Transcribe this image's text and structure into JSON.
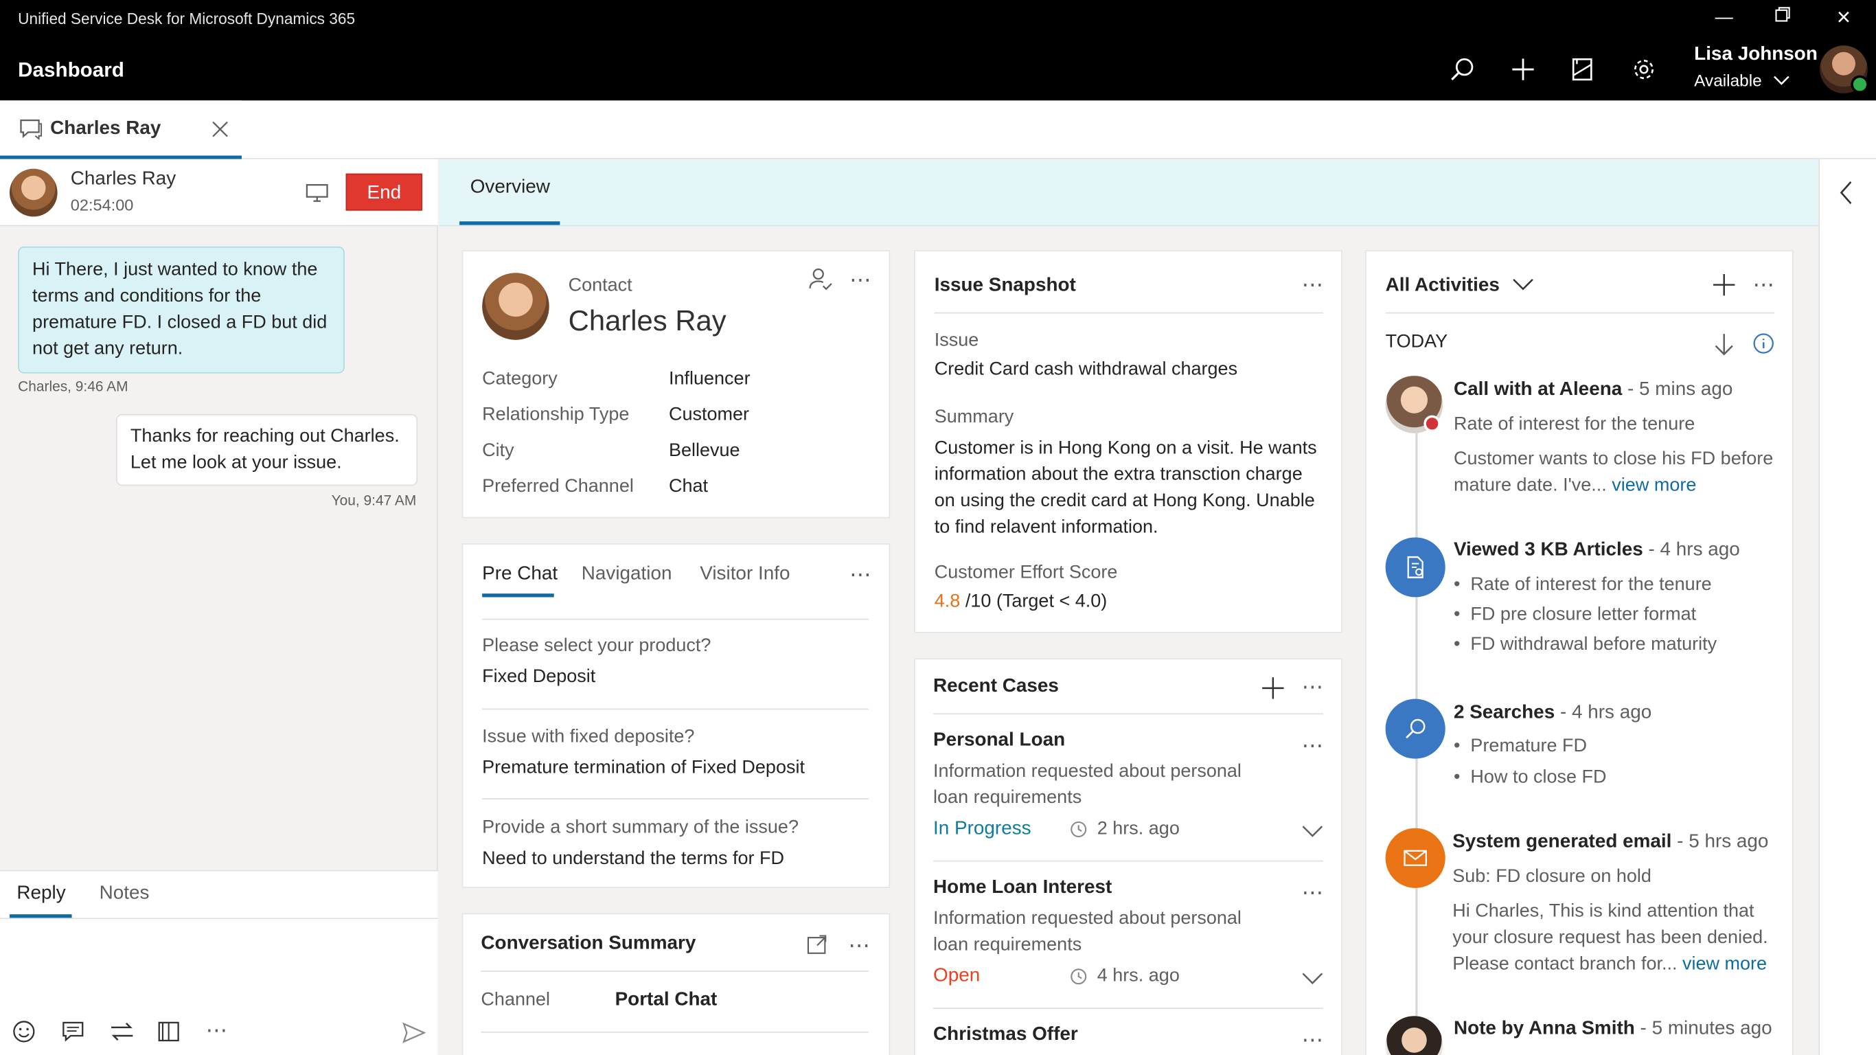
{
  "window": {
    "app_title": "Unified Service Desk for Microsoft Dynamics 365",
    "page": "Dashboard"
  },
  "user": {
    "name": "Lisa Johnson",
    "status": "Available"
  },
  "tab": {
    "label": "Charles Ray"
  },
  "session": {
    "customer": "Charles Ray",
    "timer": "02:54:00",
    "end_label": "End"
  },
  "chat": {
    "in_message": "Hi There, I just wanted to know the terms and conditions for the premature FD. I closed a FD but did not get any return.",
    "in_meta": "Charles, 9:46 AM",
    "out_message": "Thanks for reaching out Charles. Let me look at your issue.",
    "out_meta": "You, 9:47 AM"
  },
  "reply": {
    "tabs": [
      "Reply",
      "Notes"
    ]
  },
  "overview": {
    "tab": "Overview"
  },
  "contact": {
    "type_label": "Contact",
    "name": "Charles Ray",
    "fields": [
      {
        "label": "Category",
        "value": "Influencer"
      },
      {
        "label": "Relationship Type",
        "value": "Customer"
      },
      {
        "label": "City",
        "value": "Bellevue"
      },
      {
        "label": "Preferred Channel",
        "value": "Chat"
      }
    ]
  },
  "prechat": {
    "tabs": [
      "Pre Chat",
      "Navigation",
      "Visitor Info"
    ],
    "items": [
      {
        "q": "Please select your product?",
        "a": "Fixed Deposit"
      },
      {
        "q": "Issue with fixed deposite?",
        "a": "Premature termination of Fixed Deposit"
      },
      {
        "q": "Provide a short summary of the issue?",
        "a": "Need to understand the terms for FD"
      }
    ]
  },
  "conversation": {
    "title": "Conversation Summary",
    "channel_label": "Channel",
    "channel_value": "Portal Chat"
  },
  "issue": {
    "title": "Issue Snapshot",
    "issue_label": "Issue",
    "issue_value": "Credit Card cash withdrawal charges",
    "summary_label": "Summary",
    "summary_value": "Customer is in Hong Kong on a visit. He wants information about the extra transction charge on using the credit card at Hong Kong. Unable to find relavent information.",
    "ces_label": "Customer Effort Score",
    "ces_score": "4.8",
    "ces_rest": "/10 (Target < 4.0)"
  },
  "cases": {
    "title": "Recent Cases",
    "items": [
      {
        "title": "Personal Loan",
        "desc": "Information requested about personal loan requirements",
        "status": "In Progress",
        "age": "2 hrs. ago"
      },
      {
        "title": "Home Loan Interest",
        "desc": "Information requested about personal loan requirements",
        "status": "Open",
        "age": "4 hrs. ago"
      },
      {
        "title": "Christmas Offer"
      }
    ]
  },
  "activities": {
    "title": "All Activities",
    "today": "TODAY",
    "items": [
      {
        "title": "Call with at Aleena",
        "time": "- 5 mins ago",
        "line1": "Rate of interest for the tenure",
        "line2": "Customer wants to close his FD before mature date. I've...",
        "more": "view more"
      },
      {
        "title": "Viewed 3 KB Articles",
        "time": "- 4 hrs ago",
        "bullets": [
          "Rate of interest for the tenure",
          "FD pre closure letter format",
          "FD withdrawal before maturity"
        ]
      },
      {
        "title": "2 Searches",
        "time": "- 4 hrs ago",
        "bullets": [
          "Premature FD",
          "How to close FD"
        ]
      },
      {
        "title": "System generated email",
        "time": "- 5 hrs ago",
        "line1": "Sub: FD closure on hold",
        "line2": "Hi Charles, This is kind attention that your closure request has been denied. Please contact branch for...",
        "more": "view more"
      },
      {
        "title": "Note by Anna Smith",
        "time": "- 5 minutes ago"
      }
    ]
  },
  "colors": {
    "accent": "#0f6ba0",
    "end": "#e0382f",
    "open": "#e8411d",
    "score": "#e8701a",
    "email": "#ea7413",
    "kb": "#3b78c3"
  }
}
